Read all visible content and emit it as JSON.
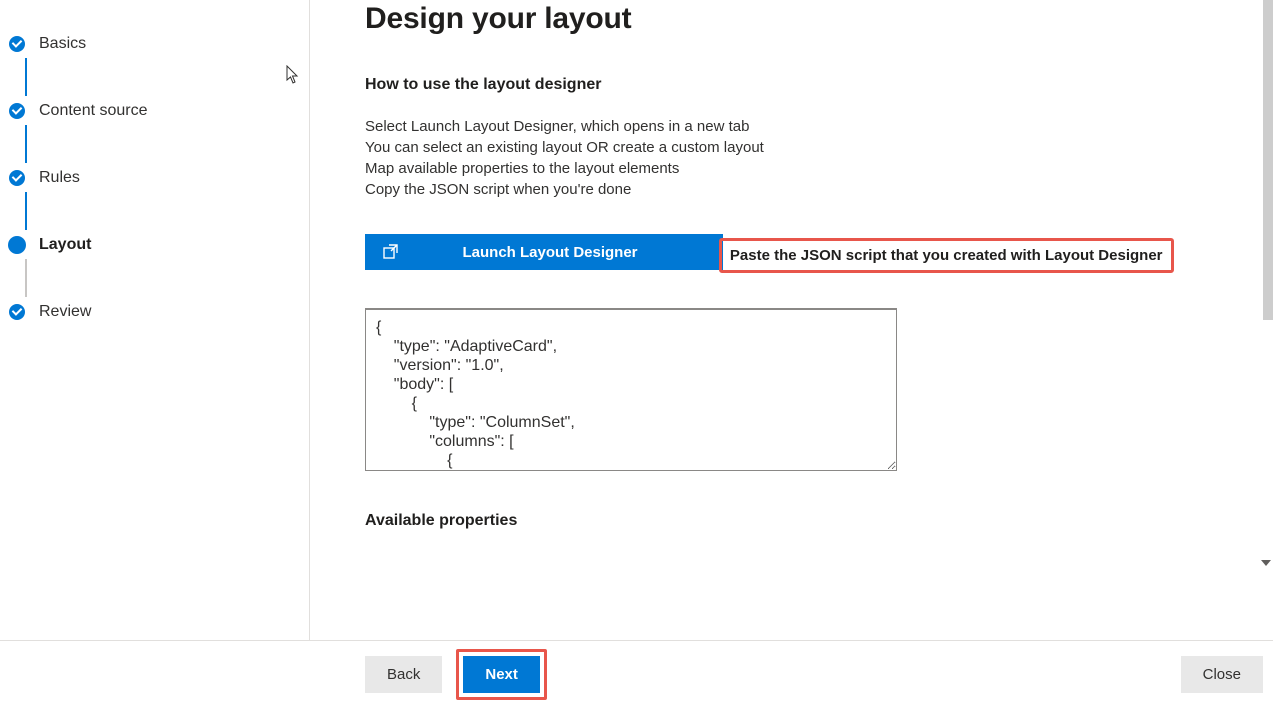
{
  "sidebar": {
    "steps": [
      {
        "label": "Basics",
        "state": "complete"
      },
      {
        "label": "Content source",
        "state": "complete"
      },
      {
        "label": "Rules",
        "state": "complete"
      },
      {
        "label": "Layout",
        "state": "current"
      },
      {
        "label": "Review",
        "state": "complete"
      }
    ]
  },
  "main": {
    "title": "Design your layout",
    "howto_heading": "How to use the layout designer",
    "instructions": [
      "Select Launch Layout Designer, which opens in a new tab",
      "You can select an existing layout OR create a custom layout",
      "Map available properties to the layout elements",
      "Copy the JSON script when you're done"
    ],
    "launch_button_label": "Launch Layout Designer",
    "json_field_label": "Paste the JSON script that you created with Layout Designer",
    "json_value": "{\n    \"type\": \"AdaptiveCard\",\n    \"version\": \"1.0\",\n    \"body\": [\n        {\n            \"type\": \"ColumnSet\",\n            \"columns\": [\n                {\n                    \"type\": \"Column\",",
    "available_heading": "Available properties"
  },
  "footer": {
    "back_label": "Back",
    "next_label": "Next",
    "close_label": "Close"
  }
}
